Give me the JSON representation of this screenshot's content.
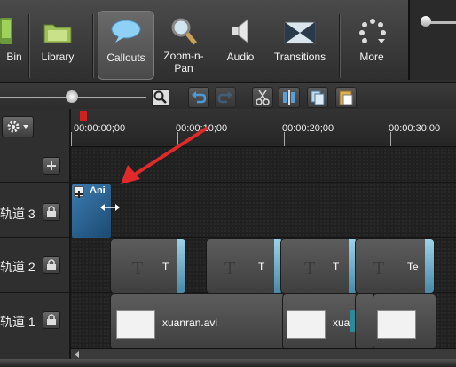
{
  "toolbar": {
    "tabs": [
      {
        "id": "bin",
        "label": "Bin"
      },
      {
        "id": "library",
        "label": "Library"
      },
      {
        "id": "callouts",
        "label": "Callouts"
      },
      {
        "id": "zoom_n_pan",
        "label_line1": "Zoom-n-",
        "label_line2": "Pan"
      },
      {
        "id": "audio",
        "label": "Audio"
      },
      {
        "id": "transitions",
        "label": "Transitions"
      },
      {
        "id": "more",
        "label": "More"
      }
    ],
    "active_tab": "Callouts"
  },
  "ruler": {
    "times": [
      "00:00:00;00",
      "00:00:10;00",
      "00:00:20;00",
      "00:00:30;00"
    ]
  },
  "tracks": [
    {
      "label": "轨道 3"
    },
    {
      "label": "轨道 2"
    },
    {
      "label": "轨道 1"
    }
  ],
  "track3": {
    "clip_label": "Ani"
  },
  "track2": {
    "clips": [
      "T",
      "T",
      "T",
      "Te"
    ]
  },
  "track1": {
    "clips": [
      "xuanran.avi",
      "xua"
    ]
  },
  "colors": {
    "callout_clip": "#2e6a98",
    "transition_edge": "#8ecbe3",
    "arrow": "#e02a2a"
  }
}
